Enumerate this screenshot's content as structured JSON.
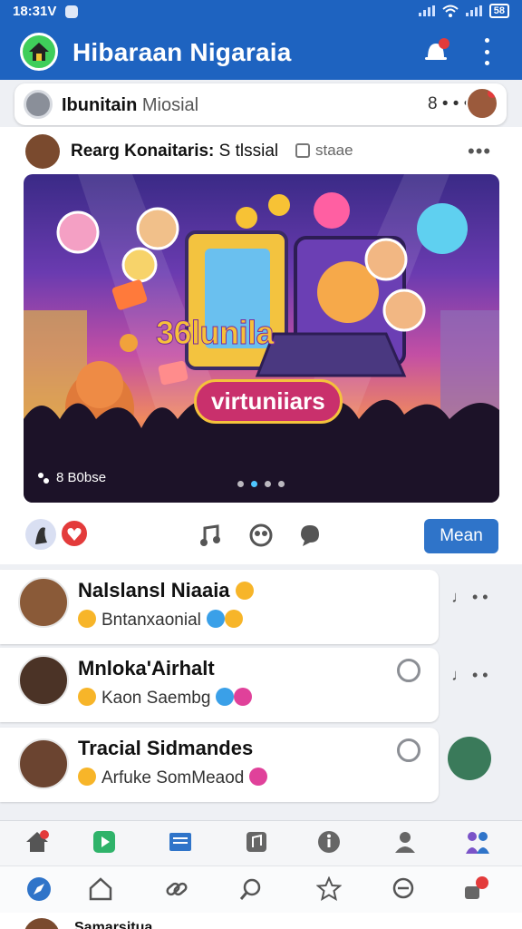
{
  "status": {
    "time": "18:31V",
    "battery": "58"
  },
  "app": {
    "title": "Hibaraan Nigaraia"
  },
  "strip": {
    "title_bold": "Ibunitain",
    "title_rest": " Miosial",
    "count": "8 • • • •"
  },
  "post": {
    "author": "Rearg Konaitaris:",
    "author_rest": "S tlssial",
    "tag": "staae",
    "hero_title": "36lunila",
    "hero_subtitle": "virtuniiars",
    "hero_count": "8 B0bse",
    "main_button": "Mean"
  },
  "feed": [
    {
      "title": "Nalslansl Niaaiа",
      "subtitle": "Bntanxaonial",
      "side": "♩ • •"
    },
    {
      "title": "Mnloka'Airhalt",
      "subtitle": "Kaon Saembg",
      "side": "♩ • •"
    },
    {
      "title": "Tracial Sidmandes",
      "subtitle": "Arfuke SomMeaod",
      "side": ""
    }
  ],
  "peek": {
    "text": "Samarsitua"
  },
  "icons": {
    "app_logo": "home-icon",
    "bell": "bell-icon",
    "more": "more-vert-icon",
    "actions": [
      "music-note-icon",
      "group-icon",
      "chat-bubble-icon"
    ],
    "nav_top": [
      "home-icon",
      "play-icon",
      "book-icon",
      "music-icon",
      "info-icon",
      "user-icon",
      "friends-icon"
    ],
    "nav_bottom": [
      "compass-icon",
      "home-outline-icon",
      "link-icon",
      "search-icon",
      "star-icon",
      "message-icon",
      "notification-icon"
    ]
  },
  "colors": {
    "primary": "#1e63c0",
    "accent": "#2f74c9",
    "alert": "#e33b3b"
  }
}
